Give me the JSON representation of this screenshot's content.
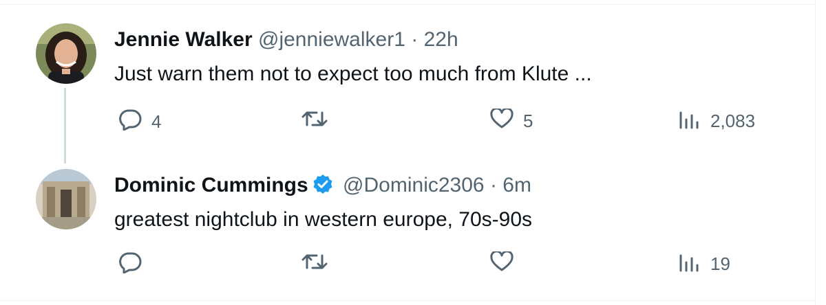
{
  "tweets": [
    {
      "name": "Jennie Walker",
      "handle": "@jenniewalker1",
      "separator": "·",
      "time": "22h",
      "verified": false,
      "text": "Just warn them not to expect too much from Klute ...",
      "replies": "4",
      "retweets": "",
      "likes": "5",
      "views": "2,083"
    },
    {
      "name": "Dominic Cummings",
      "handle": "@Dominic2306",
      "separator": "·",
      "time": "6m",
      "verified": true,
      "text": "greatest nightclub in western europe, 70s-90s",
      "replies": "",
      "retweets": "",
      "likes": "",
      "views": "19"
    }
  ],
  "colors": {
    "text_primary": "#0f1419",
    "text_secondary": "#536471",
    "verified_blue": "#1d9bf0",
    "thread_line": "#cfd9de"
  },
  "icons": {
    "reply": "reply-icon",
    "retweet": "retweet-icon",
    "like": "heart-icon",
    "views": "views-bar-chart-icon",
    "verified": "verified-badge-icon"
  }
}
